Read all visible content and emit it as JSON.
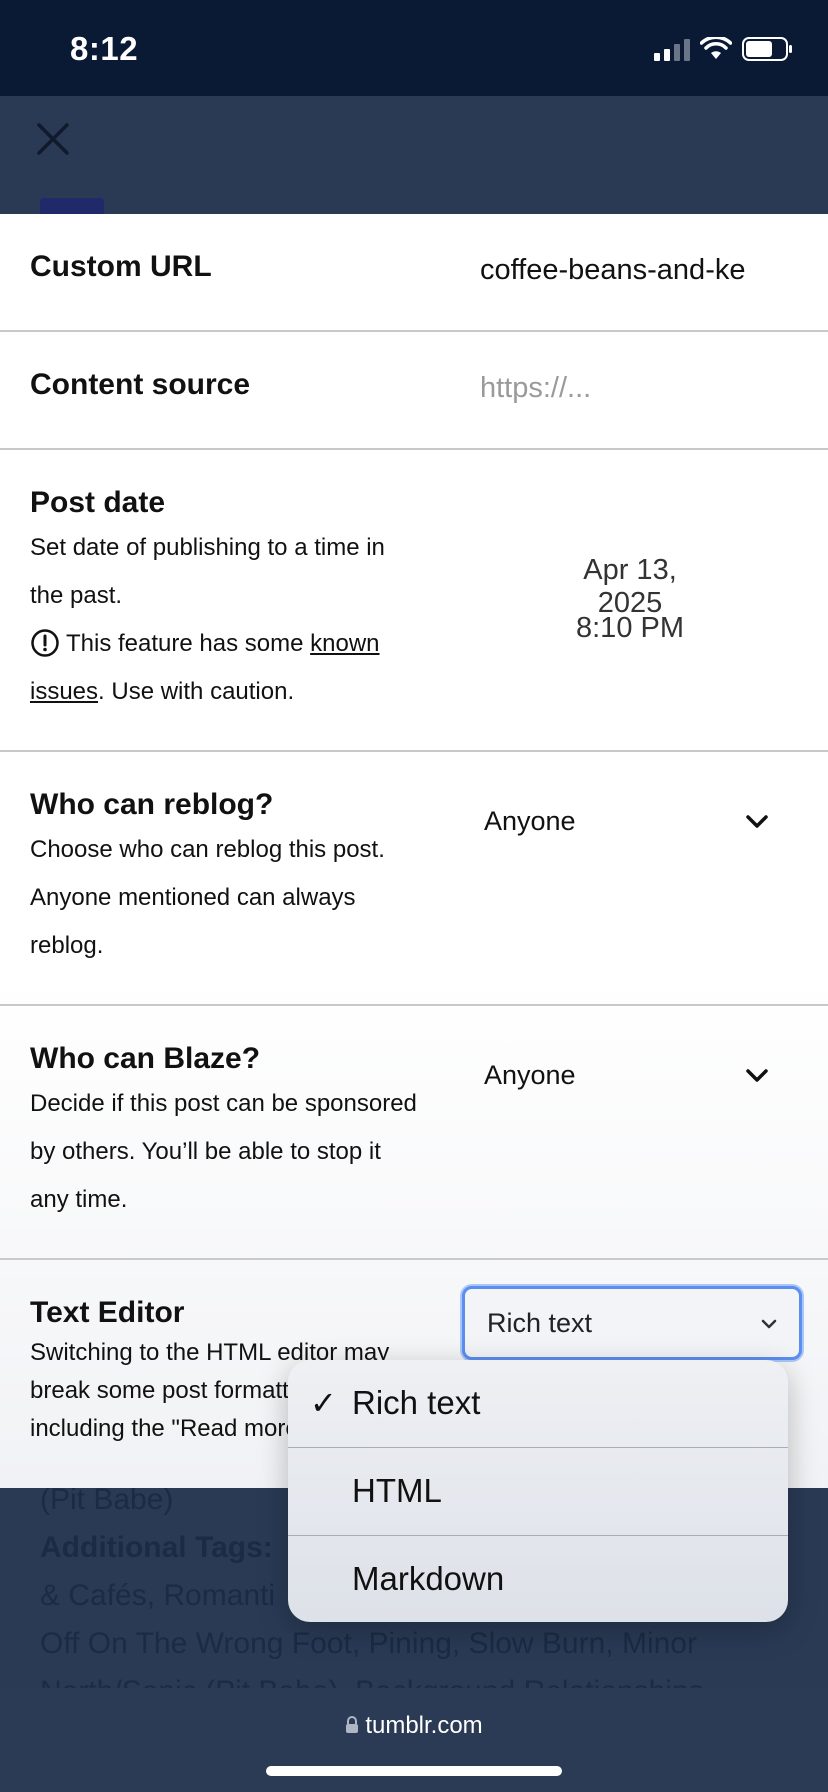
{
  "status_bar": {
    "time": "8:12"
  },
  "background_page": {
    "close_icon": "close-icon",
    "text_line1": "(Pit Babe)",
    "additional_tags_label": "Additional Tags:",
    "text_line3": "& Cafés, Romanti",
    "text_line4": "Off On The Wrong Foot, Pining, Slow Burn, Minor",
    "text_line5": "North/Sonic (Pit Babe), Background Relationships"
  },
  "settings": {
    "custom_url": {
      "label": "Custom URL",
      "value": "coffee-beans-and-ke"
    },
    "content_source": {
      "label": "Content source",
      "placeholder": "https://..."
    },
    "post_date": {
      "label": "Post date",
      "desc_line1": "Set date of publishing to a time in",
      "desc_line2": "the past.",
      "warning_pre": "This feature has some ",
      "warning_link1": "known",
      "warning_link2": "issues",
      "warning_post": ". Use with caution.",
      "date": "Apr 13, 2025",
      "time": "8:10 PM"
    },
    "reblog": {
      "label": "Who can reblog?",
      "desc_line1": "Choose who can reblog this post.",
      "desc_line2": "Anyone mentioned can always",
      "desc_line3": "reblog.",
      "value": "Anyone"
    },
    "blaze": {
      "label": "Who can Blaze?",
      "desc_line1": "Decide if this post can be sponsored",
      "desc_line2": "by others. You’ll be able to stop it",
      "desc_line3": "any time.",
      "value": "Anyone"
    },
    "text_editor": {
      "label": "Text Editor",
      "desc_line1": "Switching to the HTML editor may",
      "desc_line2": "break some post formatting,",
      "desc_line3": "including the \"Read more\"",
      "value": "Rich text"
    }
  },
  "dropdown": {
    "check_mark": "✓",
    "options": [
      "Rich text",
      "HTML",
      "Markdown"
    ],
    "selected": "Rich text"
  },
  "browser": {
    "url": "tumblr.com"
  },
  "colors": {
    "accent": "#5a8ef0",
    "navy": "#0a1a35",
    "sheet": "#ffffff"
  }
}
